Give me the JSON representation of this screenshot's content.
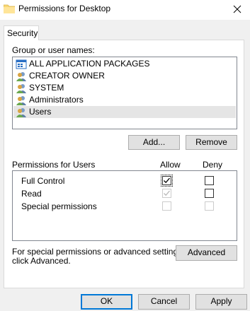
{
  "window": {
    "title": "Permissions for Desktop"
  },
  "tabs": [
    {
      "label": "Security"
    }
  ],
  "group_section": {
    "label": "Group or user names:",
    "items": [
      {
        "label": "ALL APPLICATION PACKAGES",
        "icon": "app-packages-icon"
      },
      {
        "label": "CREATOR OWNER",
        "icon": "users-icon"
      },
      {
        "label": "SYSTEM",
        "icon": "users-icon"
      },
      {
        "label": "Administrators",
        "icon": "users-icon"
      },
      {
        "label": "Users",
        "icon": "users-icon",
        "selected": true
      }
    ],
    "add_button": "Add...",
    "remove_button": "Remove"
  },
  "permissions": {
    "header": "Permissions for Users",
    "allow_header": "Allow",
    "deny_header": "Deny",
    "rows": [
      {
        "name": "Full Control",
        "allow": "checked-focused",
        "deny": "unchecked"
      },
      {
        "name": "Read",
        "allow": "checked-disabled",
        "deny": "unchecked"
      },
      {
        "name": "Special permissions",
        "allow": "disabled",
        "deny": "disabled"
      }
    ]
  },
  "advanced": {
    "text_line1": "For special permissions or advanced settings,",
    "text_line2": "click Advanced.",
    "button": "Advanced"
  },
  "footer": {
    "ok": "OK",
    "cancel": "Cancel",
    "apply": "Apply"
  },
  "colors": {
    "selection": "#e5e5e5",
    "focus_border": "#0078d7",
    "folder": "#f8d775"
  }
}
